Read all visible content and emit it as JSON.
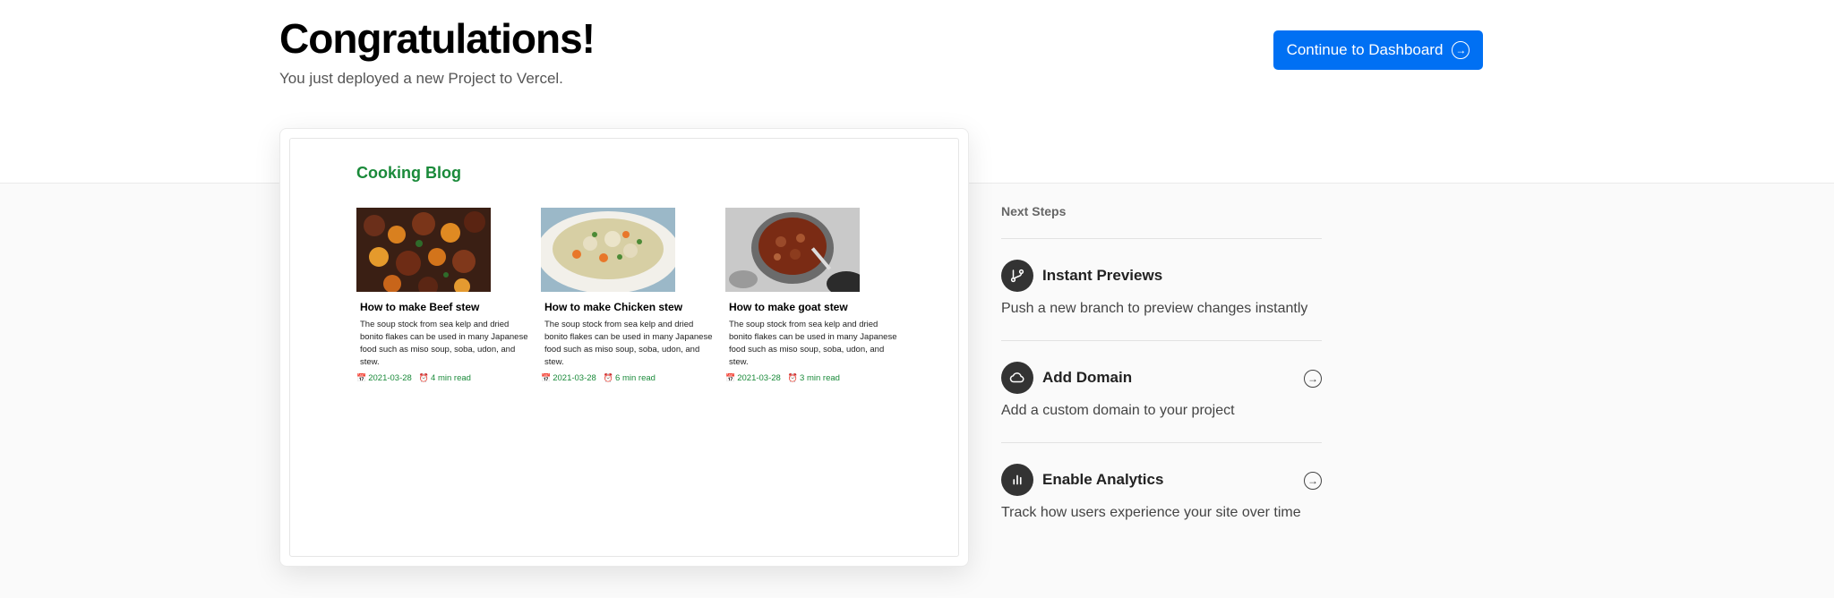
{
  "header": {
    "title": "Congratulations!",
    "subtitle": "You just deployed a new Project to Vercel.",
    "cta_label": "Continue to Dashboard",
    "cta_icon": "arrow-right-circle-icon",
    "accent_color": "#0070f3"
  },
  "preview": {
    "blog_title": "Cooking Blog",
    "blog_title_color": "#1a8a3a",
    "posts": [
      {
        "image": "beef-stew-photo",
        "title": "How to make Beef stew",
        "description": "The soup stock from sea kelp and dried bonito flakes can be used in many Japanese food such as miso soup, soba, udon, and stew.",
        "date": "2021-03-28",
        "read_time": "4 min read"
      },
      {
        "image": "chicken-stew-photo",
        "title": "How to make Chicken stew",
        "description": "The soup stock from sea kelp and dried bonito flakes can be used in many Japanese food such as miso soup, soba, udon, and stew.",
        "date": "2021-03-28",
        "read_time": "6 min read"
      },
      {
        "image": "goat-stew-photo",
        "title": "How to make goat stew",
        "description": "The soup stock from sea kelp and dried bonito flakes can be used in many Japanese food such as miso soup, soba, udon, and stew.",
        "date": "2021-03-28",
        "read_time": "3 min read"
      }
    ]
  },
  "next_steps": {
    "label": "Next Steps",
    "items": [
      {
        "icon": "git-branch-icon",
        "title": "Instant Previews",
        "description": "Push a new branch to preview changes instantly",
        "has_arrow": false
      },
      {
        "icon": "cloud-icon",
        "title": "Add Domain",
        "description": "Add a custom domain to your project",
        "has_arrow": true
      },
      {
        "icon": "bar-chart-icon",
        "title": "Enable Analytics",
        "description": "Track how users experience your site over time",
        "has_arrow": true
      }
    ]
  }
}
